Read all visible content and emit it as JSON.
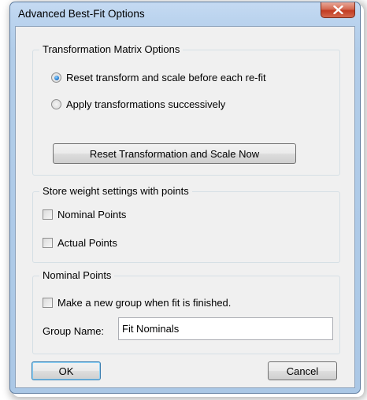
{
  "window": {
    "title": "Advanced Best-Fit Options"
  },
  "transformation_group": {
    "legend": "Transformation Matrix Options",
    "options": [
      {
        "label": "Reset transform and scale before each re-fit",
        "selected": true
      },
      {
        "label": "Apply transformations successively",
        "selected": false
      }
    ],
    "reset_button": "Reset Transformation and Scale Now"
  },
  "weight_group": {
    "legend": "Store weight settings with points",
    "nominal_points": {
      "label": "Nominal Points",
      "checked": false
    },
    "actual_points": {
      "label": "Actual Points",
      "checked": false
    }
  },
  "nominal_group": {
    "legend": "Nominal Points",
    "new_group": {
      "label": "Make a new group when fit is finished.",
      "checked": false
    },
    "group_name_label": "Group Name:",
    "group_name_value": "Fit Nominals"
  },
  "buttons": {
    "ok": "OK",
    "cancel": "Cancel"
  }
}
